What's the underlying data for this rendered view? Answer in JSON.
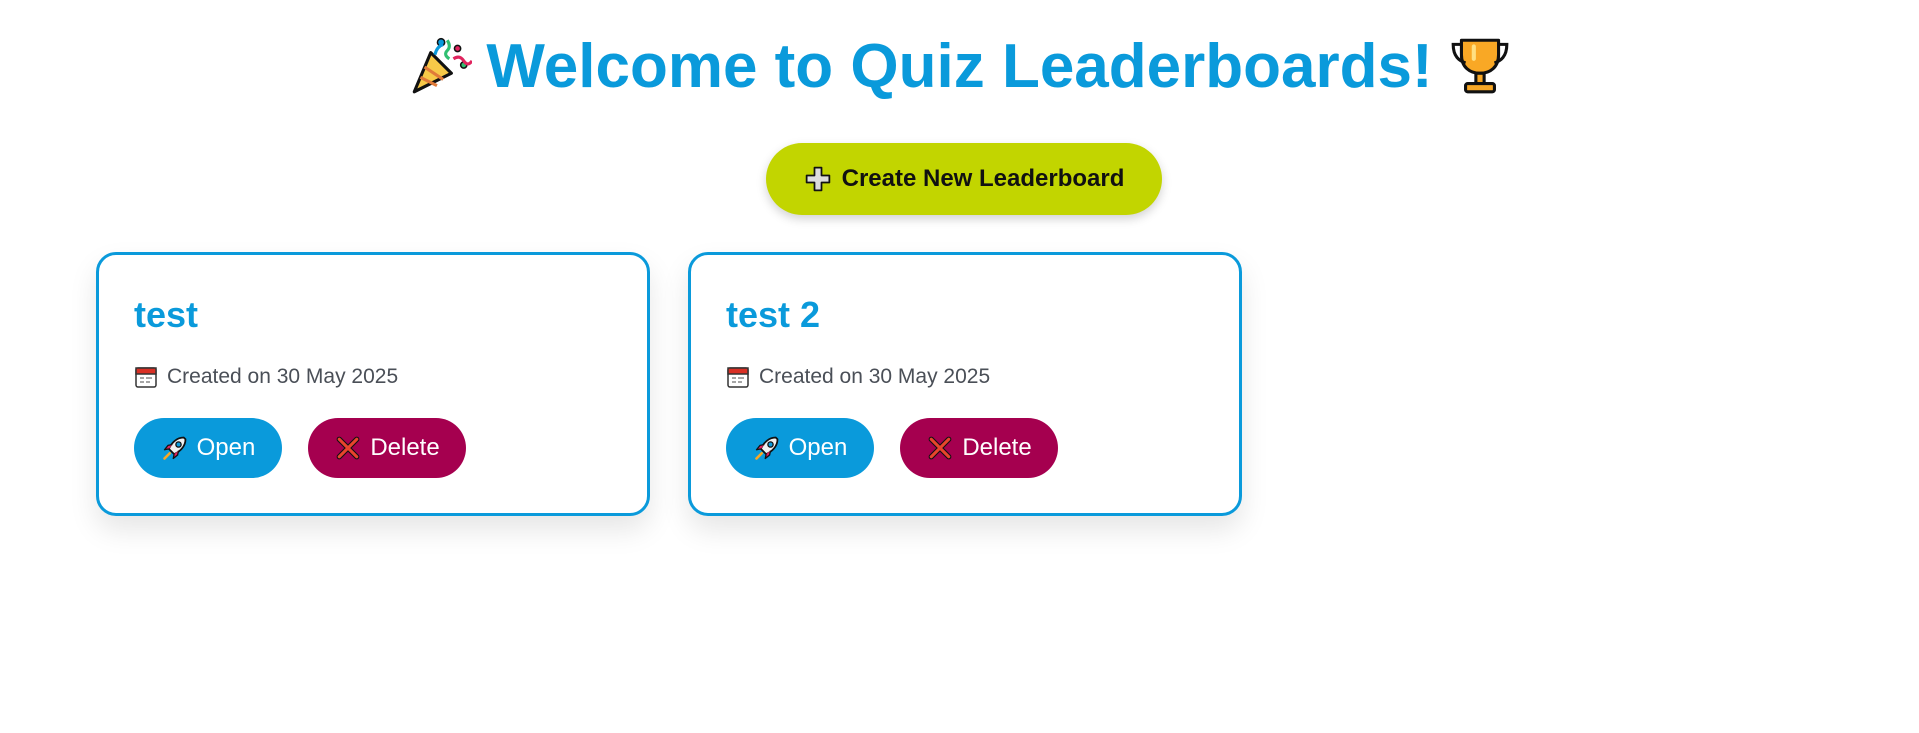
{
  "header": {
    "title": "Welcome to Quiz Leaderboards!",
    "left_icon": "party-popper-icon",
    "right_icon": "trophy-icon"
  },
  "create_button": {
    "label": "Create New Leaderboard",
    "icon": "plus-icon"
  },
  "leaderboards": [
    {
      "name": "test",
      "created": "Created on 30 May 2025",
      "open_label": "Open",
      "delete_label": "Delete"
    },
    {
      "name": "test 2",
      "created": "Created on 30 May 2025",
      "open_label": "Open",
      "delete_label": "Delete"
    }
  ],
  "colors": {
    "primary": "#0a9adb",
    "accent": "#c2d500",
    "danger": "#a5004f",
    "meta_text": "#4a4f57"
  }
}
